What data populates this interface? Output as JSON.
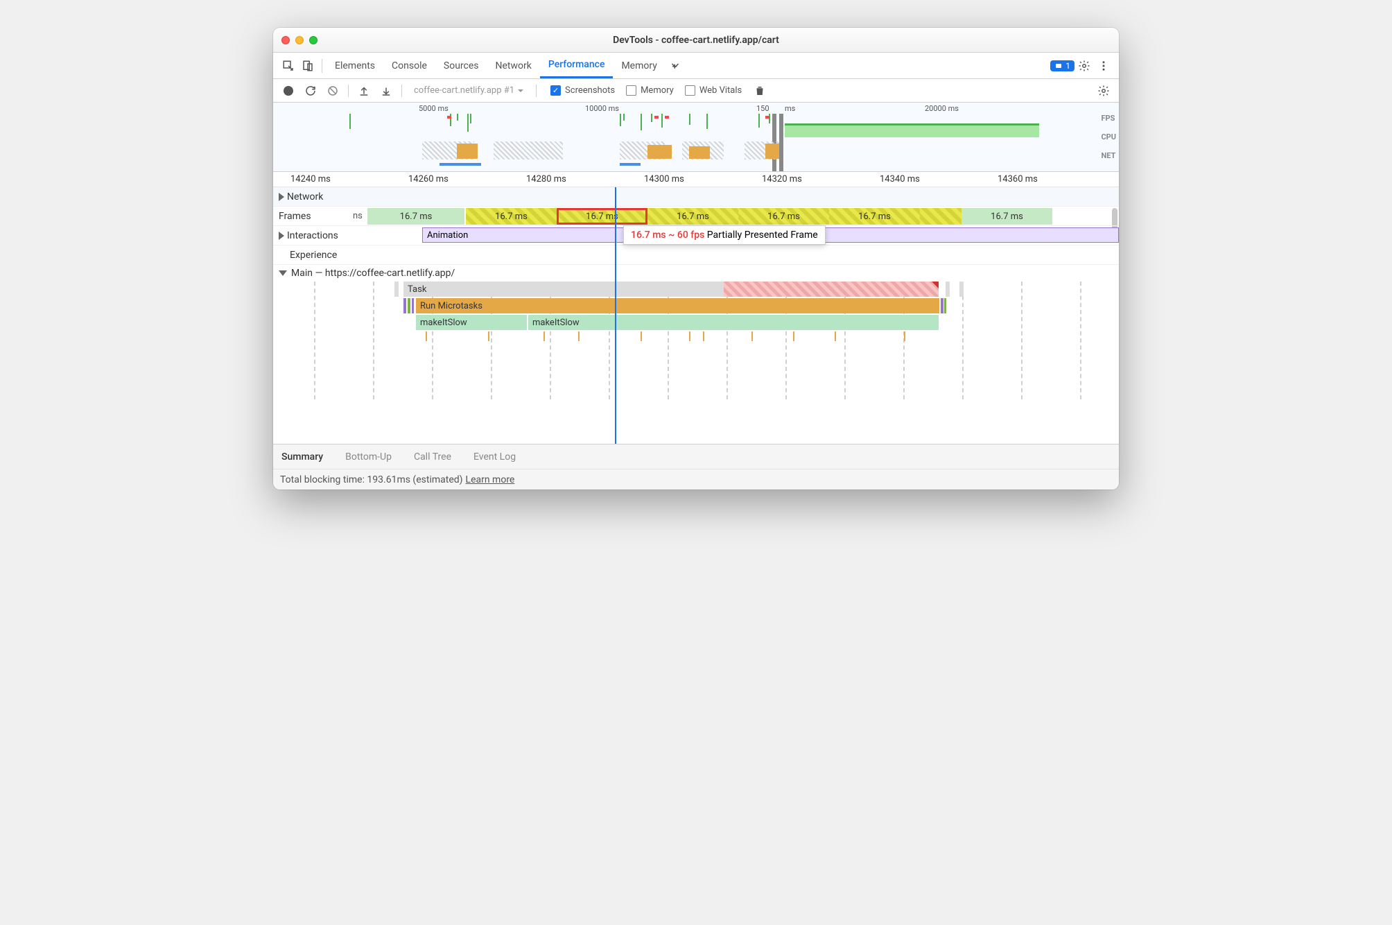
{
  "window": {
    "title": "DevTools - coffee-cart.netlify.app/cart"
  },
  "tabs": {
    "items": [
      "Elements",
      "Console",
      "Sources",
      "Network",
      "Performance",
      "Memory"
    ],
    "active": "Performance",
    "issuesCount": "1"
  },
  "toolbar": {
    "recording": "coffee-cart.netlify.app #1",
    "screenshots": {
      "label": "Screenshots",
      "checked": true
    },
    "memory": {
      "label": "Memory",
      "checked": false
    },
    "webVitals": {
      "label": "Web Vitals",
      "checked": false
    }
  },
  "overview": {
    "ticks": [
      "5000 ms",
      "10000 ms",
      "150",
      "ms",
      "20000 ms"
    ],
    "labels": [
      "FPS",
      "CPU",
      "NET"
    ]
  },
  "ruler": {
    "ticks": [
      "14240 ms",
      "14260 ms",
      "14280 ms",
      "14300 ms",
      "14320 ms",
      "14340 ms",
      "14360 ms"
    ]
  },
  "tracks": {
    "network": "Network",
    "frames": {
      "label": "Frames",
      "truncated": "ns",
      "values": [
        "16.7 ms",
        "16.7 ms",
        "16.7 ms",
        "16.7 ms",
        "16.7 ms",
        "16.7 ms",
        "16.7 ms"
      ]
    },
    "interactions": {
      "label": "Interactions",
      "value": "Animation"
    },
    "experience": "Experience",
    "main": "Main — https://coffee-cart.netlify.app/",
    "task": "Task",
    "microtasks": "Run Microtasks",
    "fn1": "makeItSlow",
    "fn2": "makeItSlow"
  },
  "tooltip": {
    "time": "16.7 ms ~ 60 fps",
    "label": "Partially Presented Frame"
  },
  "bottomTabs": {
    "items": [
      "Summary",
      "Bottom-Up",
      "Call Tree",
      "Event Log"
    ],
    "active": "Summary"
  },
  "status": {
    "text": "Total blocking time: 193.61ms (estimated)",
    "link": "Learn more"
  }
}
